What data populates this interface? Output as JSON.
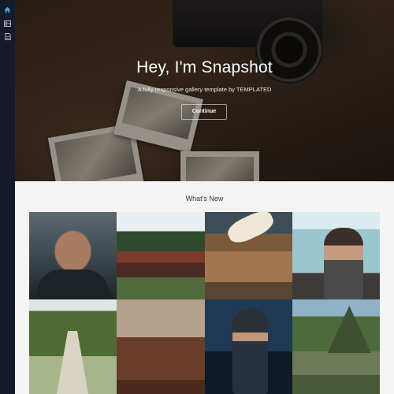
{
  "sidebar": {
    "items": [
      {
        "icon": "home-icon",
        "active": true
      },
      {
        "icon": "gallery-icon",
        "active": false
      },
      {
        "icon": "document-icon",
        "active": false
      }
    ]
  },
  "hero": {
    "title": "Hey, I'm Snapshot",
    "subtitle": "A fully responsive gallery template by TEMPLATED",
    "button_label": "Continue"
  },
  "section": {
    "title": "What's New"
  },
  "colors": {
    "sidebar_bg": "#151b2b",
    "active_icon": "#4a9fe0",
    "icon": "#c8ccd4"
  }
}
